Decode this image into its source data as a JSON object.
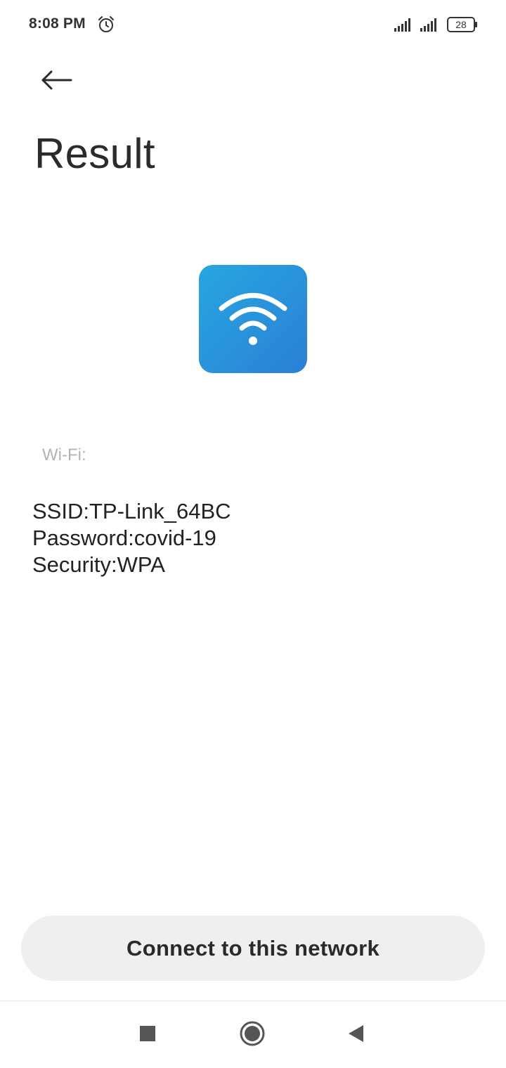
{
  "status_bar": {
    "time": "8:08 PM",
    "alarm_icon": "alarm-clock-icon",
    "signal_icon": "cell-signal-icon",
    "battery_level": "28"
  },
  "header": {
    "back_icon": "arrow-left-icon",
    "title": "Result"
  },
  "result": {
    "type_icon": "wifi-icon",
    "type_label": "Wi-Fi:",
    "ssid_line": "SSID:TP-Link_64BC",
    "password_line": "Password:covid-19",
    "security_line": "Security:WPA"
  },
  "actions": {
    "connect_label": "Connect to this network"
  },
  "nav_bar": {
    "recents_icon": "square-icon",
    "home_icon": "circle-icon",
    "back_icon": "triangle-back-icon"
  },
  "colors": {
    "tile_gradient_start": "#27a7e0",
    "tile_gradient_end": "#2b7fd6",
    "button_background": "#efefef",
    "label_gray": "#b3b3b3"
  }
}
